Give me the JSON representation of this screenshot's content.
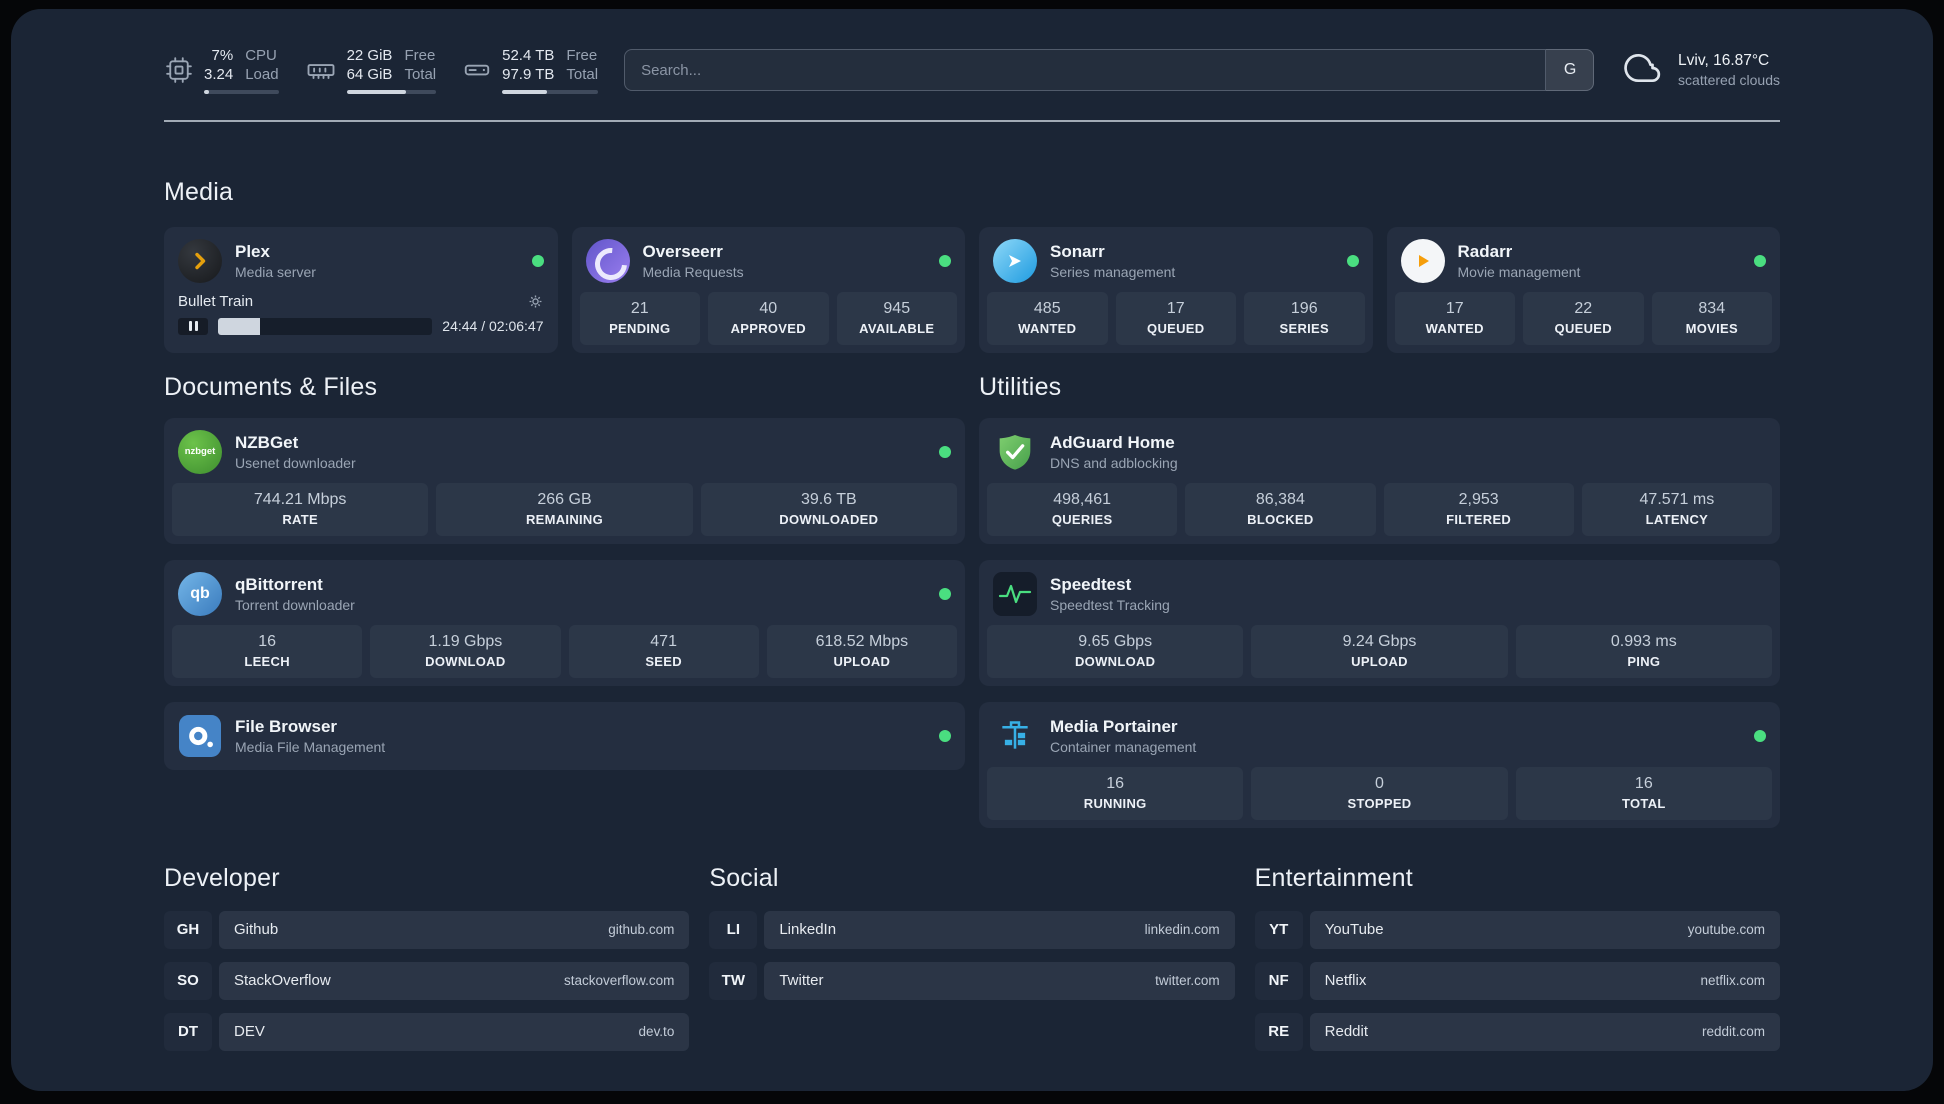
{
  "colors": {
    "background": "#1b2535",
    "card": "#242e40",
    "tile": "#2c3748",
    "status_green": "#4ade80",
    "plex_amber": "#e5a00d",
    "adguard_green": "#5cb85f",
    "portainer_blue": "#37b0e6",
    "speedtest_line": "#4ade80"
  },
  "topbar": {
    "cpu": {
      "values": [
        "7%",
        "3.24"
      ],
      "labels": [
        "CPU",
        "Load"
      ],
      "progress": 7
    },
    "memory": {
      "values": [
        "22 GiB",
        "64 GiB"
      ],
      "labels": [
        "Free",
        "Total"
      ],
      "progress": 66
    },
    "disk": {
      "values": [
        "52.4 TB",
        "97.9 TB"
      ],
      "labels": [
        "Free",
        "Total"
      ],
      "progress": 47
    },
    "search": {
      "placeholder": "Search...",
      "button_label": "G"
    },
    "weather": {
      "location": "Lviv, 16.87°C",
      "condition": "scattered clouds"
    }
  },
  "sections": {
    "media": {
      "heading": "Media",
      "plex": {
        "name": "Plex",
        "subtitle": "Media server",
        "now_playing": "Bullet Train",
        "time": "24:44 / 02:06:47",
        "progress": 19.5
      },
      "overseerr": {
        "name": "Overseerr",
        "subtitle": "Media Requests",
        "stats": [
          {
            "value": "21",
            "label": "PENDING"
          },
          {
            "value": "40",
            "label": "APPROVED"
          },
          {
            "value": "945",
            "label": "AVAILABLE"
          }
        ]
      },
      "sonarr": {
        "name": "Sonarr",
        "subtitle": "Series management",
        "stats": [
          {
            "value": "485",
            "label": "WANTED"
          },
          {
            "value": "17",
            "label": "QUEUED"
          },
          {
            "value": "196",
            "label": "SERIES"
          }
        ]
      },
      "radarr": {
        "name": "Radarr",
        "subtitle": "Movie management",
        "stats": [
          {
            "value": "17",
            "label": "WANTED"
          },
          {
            "value": "22",
            "label": "QUEUED"
          },
          {
            "value": "834",
            "label": "MOVIES"
          }
        ]
      }
    },
    "documents": {
      "heading": "Documents & Files",
      "nzbget": {
        "name": "NZBGet",
        "subtitle": "Usenet downloader",
        "icon_text": "nzbget",
        "stats": [
          {
            "value": "744.21 Mbps",
            "label": "RATE"
          },
          {
            "value": "266 GB",
            "label": "REMAINING"
          },
          {
            "value": "39.6 TB",
            "label": "DOWNLOADED"
          }
        ]
      },
      "qbittorrent": {
        "name": "qBittorrent",
        "subtitle": "Torrent downloader",
        "icon_text": "qb",
        "stats": [
          {
            "value": "16",
            "label": "LEECH"
          },
          {
            "value": "1.19 Gbps",
            "label": "DOWNLOAD"
          },
          {
            "value": "471",
            "label": "SEED"
          },
          {
            "value": "618.52 Mbps",
            "label": "UPLOAD"
          }
        ]
      },
      "filebrowser": {
        "name": "File Browser",
        "subtitle": "Media File Management"
      }
    },
    "utilities": {
      "heading": "Utilities",
      "adguard": {
        "name": "AdGuard Home",
        "subtitle": "DNS and adblocking",
        "stats": [
          {
            "value": "498,461",
            "label": "QUERIES"
          },
          {
            "value": "86,384",
            "label": "BLOCKED"
          },
          {
            "value": "2,953",
            "label": "FILTERED"
          },
          {
            "value": "47.571 ms",
            "label": "LATENCY"
          }
        ]
      },
      "speedtest": {
        "name": "Speedtest",
        "subtitle": "Speedtest Tracking",
        "stats": [
          {
            "value": "9.65 Gbps",
            "label": "DOWNLOAD"
          },
          {
            "value": "9.24 Gbps",
            "label": "UPLOAD"
          },
          {
            "value": "0.993 ms",
            "label": "PING"
          }
        ]
      },
      "portainer": {
        "name": "Media Portainer",
        "subtitle": "Container management",
        "stats": [
          {
            "value": "16",
            "label": "RUNNING"
          },
          {
            "value": "0",
            "label": "STOPPED"
          },
          {
            "value": "16",
            "label": "TOTAL"
          }
        ]
      }
    }
  },
  "bookmarks": {
    "developer": {
      "heading": "Developer",
      "items": [
        {
          "abbr": "GH",
          "name": "Github",
          "domain": "github.com"
        },
        {
          "abbr": "SO",
          "name": "StackOverflow",
          "domain": "stackoverflow.com"
        },
        {
          "abbr": "DT",
          "name": "DEV",
          "domain": "dev.to"
        }
      ]
    },
    "social": {
      "heading": "Social",
      "items": [
        {
          "abbr": "LI",
          "name": "LinkedIn",
          "domain": "linkedin.com"
        },
        {
          "abbr": "TW",
          "name": "Twitter",
          "domain": "twitter.com"
        }
      ]
    },
    "entertainment": {
      "heading": "Entertainment",
      "items": [
        {
          "abbr": "YT",
          "name": "YouTube",
          "domain": "youtube.com"
        },
        {
          "abbr": "NF",
          "name": "Netflix",
          "domain": "netflix.com"
        },
        {
          "abbr": "RE",
          "name": "Reddit",
          "domain": "reddit.com"
        }
      ]
    }
  }
}
